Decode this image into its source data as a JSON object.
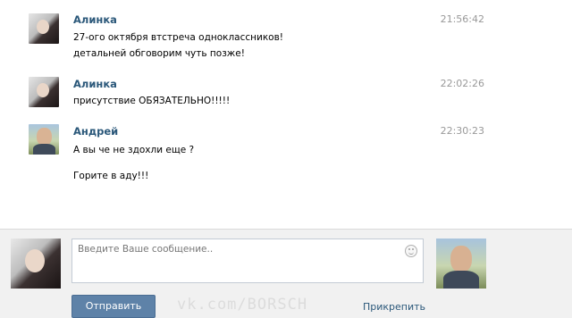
{
  "messages": [
    {
      "author": "Алинка",
      "time": "21:56:42",
      "lines": [
        "27-ого октября втстреча одноклассников!",
        "детальней обговорим чуть позже!"
      ],
      "avatar": "female-avatar-photo"
    },
    {
      "author": "Алинка",
      "time": "22:02:26",
      "lines": [
        "присутствие ОБЯЗАТЕЛЬНО!!!!!"
      ],
      "avatar": "female-avatar-photo"
    },
    {
      "author": "Андрей",
      "time": "22:30:23",
      "lines": [
        "А вы че не здохли еще ?",
        "Горите в аду!!!"
      ],
      "avatar": "male-avatar-photo"
    }
  ],
  "composer": {
    "placeholder": "Введите Ваше сообщение..",
    "send_label": "Отправить",
    "attach_label": "Прикрепить",
    "watermark": "vk.com/BORSCH",
    "smile_icon": "smile-icon"
  },
  "colors": {
    "author_link": "#2b587a",
    "time": "#999999",
    "send_button": "#5e82a8",
    "composer_bg": "#f1f1f1"
  }
}
